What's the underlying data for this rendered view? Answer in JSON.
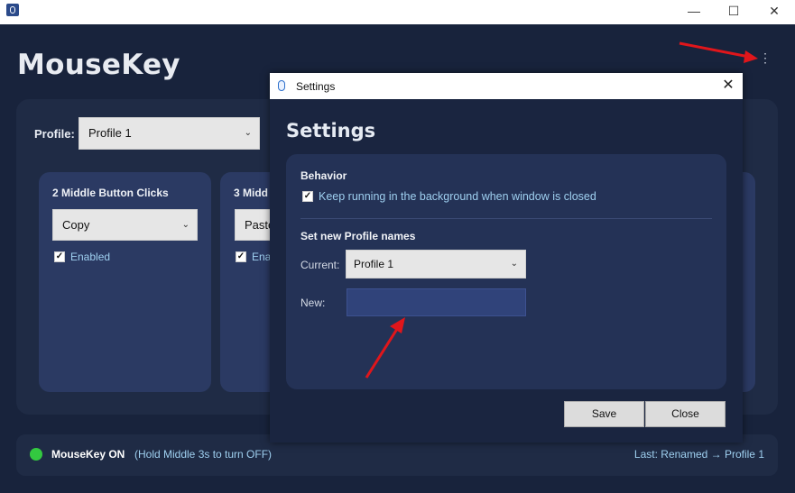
{
  "window": {
    "minimize_icon": "minimize-icon",
    "maximize_icon": "maximize-icon",
    "close_icon": "close-icon"
  },
  "app": {
    "title": "MouseKey",
    "menu_icon": "kebab-menu-icon"
  },
  "profile": {
    "label": "Profile:",
    "selected": "Profile 1"
  },
  "cards": [
    {
      "title": "2 Middle Button Clicks",
      "action": "Copy",
      "enabled_label": "Enabled",
      "enabled": true
    },
    {
      "title": "3 Midd",
      "action": "Paste",
      "enabled_label": "Ena",
      "enabled": true
    }
  ],
  "status": {
    "state": "MouseKey ON",
    "hint": "(Hold Middle 3s to turn OFF)",
    "last": "Last: Renamed → Profile 1",
    "indicator_color": "#33c940"
  },
  "dialog": {
    "window_title": "Settings",
    "heading": "Settings",
    "behavior": {
      "title": "Behavior",
      "keep_running_label": "Keep running in the background when window is closed",
      "keep_running_checked": true
    },
    "rename": {
      "title": "Set new Profile names",
      "current_label": "Current:",
      "current_value": "Profile 1",
      "new_label": "New:",
      "new_value": ""
    },
    "buttons": {
      "save": "Save",
      "close": "Close"
    }
  },
  "colors": {
    "background": "#18233c",
    "panel": "#1f2b45",
    "card": "#2b3a63",
    "accent_text": "#9fd0f0",
    "annotation_arrow": "#e0161b"
  }
}
